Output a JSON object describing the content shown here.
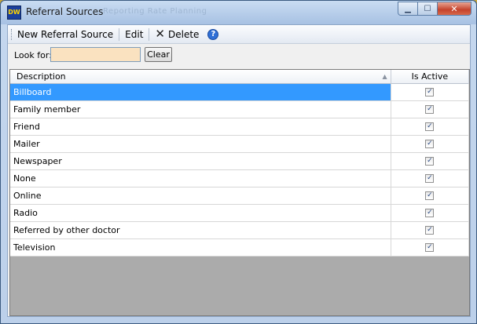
{
  "window": {
    "app_icon": "DW",
    "title": "Referral Sources",
    "background_menu": "Reporting   Rate Planning"
  },
  "toolbar": {
    "new_label": "New Referral Source",
    "edit_label": "Edit",
    "delete_label": "Delete",
    "help_glyph": "?"
  },
  "search": {
    "label": "Look for:",
    "value": "",
    "clear_label": "Clear"
  },
  "grid": {
    "columns": [
      "Description",
      "Is Active"
    ],
    "rows": [
      {
        "description": "Billboard",
        "active": true
      },
      {
        "description": "Family member",
        "active": true
      },
      {
        "description": "Friend",
        "active": true
      },
      {
        "description": "Mailer",
        "active": true
      },
      {
        "description": "Newspaper",
        "active": true
      },
      {
        "description": "None",
        "active": true
      },
      {
        "description": "Online",
        "active": true
      },
      {
        "description": "Radio",
        "active": true
      },
      {
        "description": "Referred by other doctor",
        "active": true
      },
      {
        "description": "Television",
        "active": true
      }
    ],
    "selected_row": 0
  },
  "colors": {
    "selection": "#3399ff",
    "search_field": "#fae2c0",
    "grid_empty": "#ababab"
  }
}
